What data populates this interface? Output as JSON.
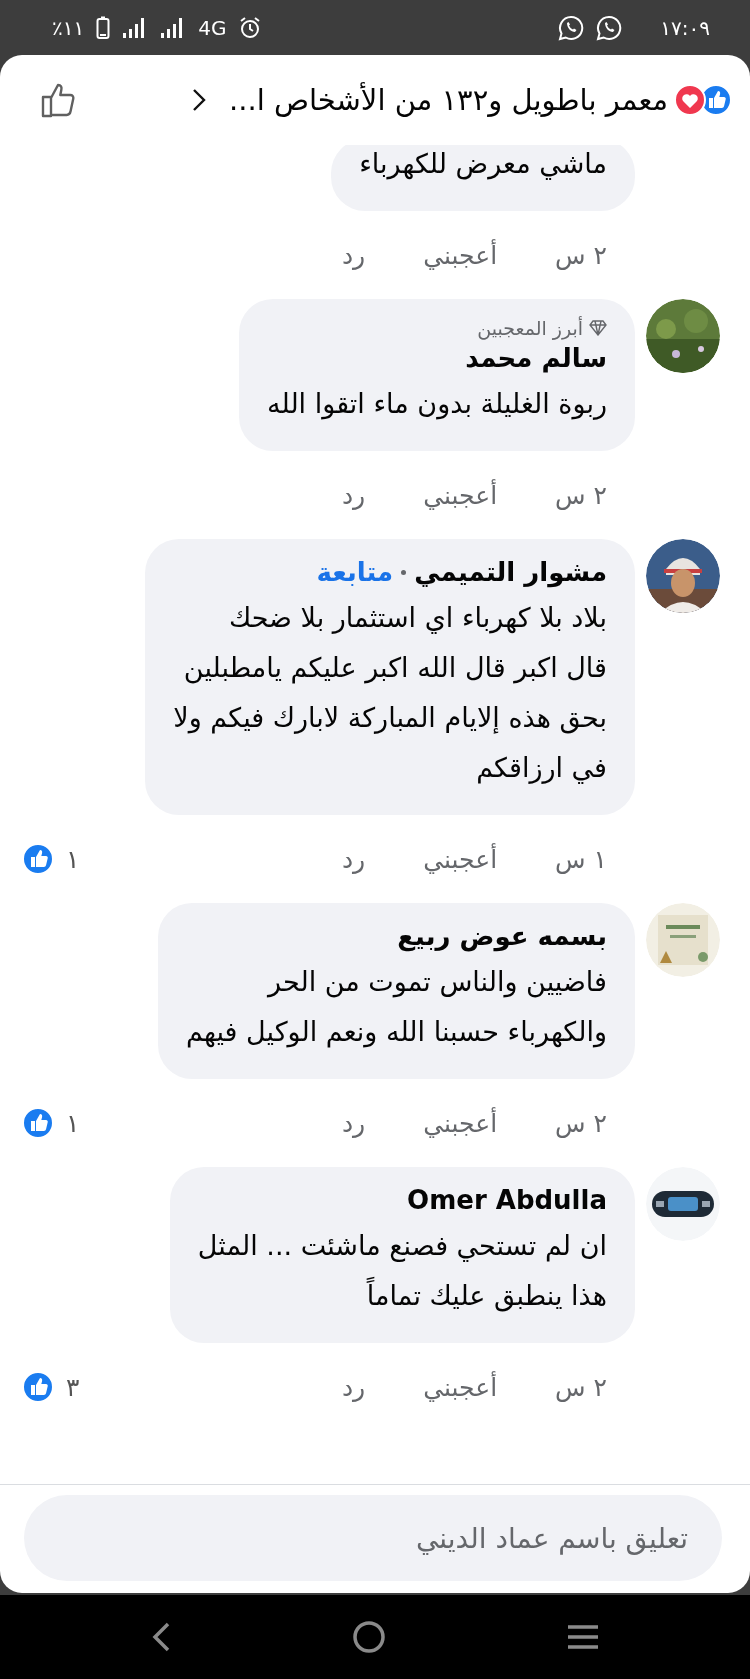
{
  "status_bar": {
    "time": "١٧:٠٩",
    "network": "4G",
    "battery": "٪١١"
  },
  "header": {
    "title": "معمر باطويل و١٣٢ من الأشخاص ا..."
  },
  "comments": [
    {
      "kind": "cut",
      "lines": [
        "ماشي معرض للكهرباء"
      ],
      "time": "٢ س",
      "like": "أعجبني",
      "reply": "رد"
    },
    {
      "kind": "full",
      "name": "سالم محمد",
      "badge": "أبرز المعجبين",
      "lines": [
        "ربوة الغليلة بدون ماء اتقوا الله"
      ],
      "time": "٢ س",
      "like": "أعجبني",
      "reply": "رد"
    },
    {
      "kind": "full",
      "name": "مشوار التميمي",
      "follow": "متابعة",
      "lines": [
        "بلاد بلا كهرباء اي استثمار بلا ضحك",
        "قال اكبر قال الله اكبر عليكم يامطبلين",
        "بحق هذه إلايام المباركة لابارك فيكم ولا",
        "في ارزاقكم"
      ],
      "time": "١ س",
      "like": "أعجبني",
      "reply": "رد",
      "likes": "١"
    },
    {
      "kind": "full",
      "name": "بسمه عوض ربيع",
      "lines": [
        "فاضيين والناس تموت من الحر",
        "والكهرباء حسبنا الله ونعم الوكيل فيهم"
      ],
      "time": "٢ س",
      "like": "أعجبني",
      "reply": "رد",
      "likes": "١"
    },
    {
      "kind": "full",
      "name": "Omer Abdulla",
      "lines": [
        "ان لم تستحي فصنع ماشئت ... المثل",
        "هذا ينطبق عليك تماماً"
      ],
      "time": "٢ س",
      "like": "أعجبني",
      "reply": "رد",
      "likes": "٣"
    }
  ],
  "composer": {
    "placeholder": "تعليق باسم عماد الديني"
  }
}
